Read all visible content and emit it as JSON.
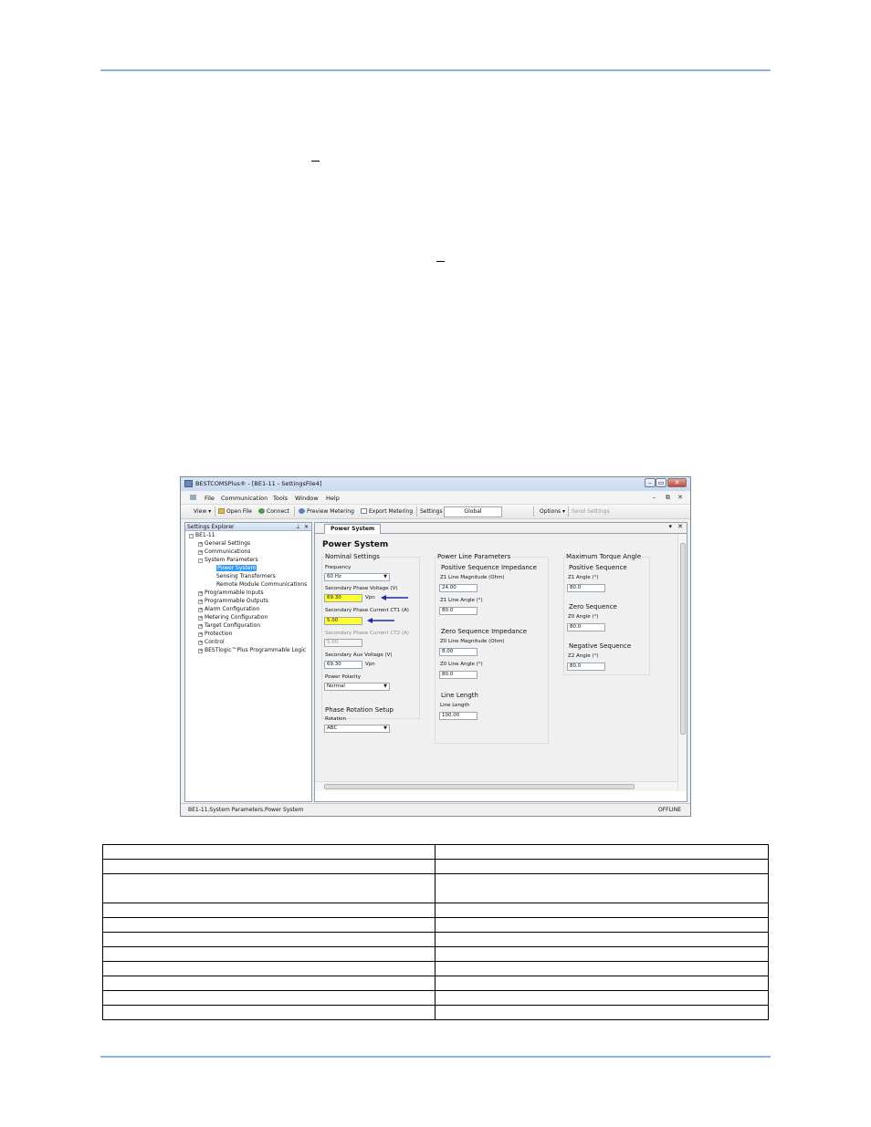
{
  "window": {
    "title": "BESTCOMSPlus® - [BE1-11 - SettingsFile4]",
    "controls": {
      "minimize": "–",
      "restore": "▭",
      "close": "✕"
    }
  },
  "menu": {
    "items": [
      "File",
      "Communication",
      "Tools",
      "Window",
      "Help"
    ],
    "right_controls": [
      "–",
      "⧉",
      "✕"
    ]
  },
  "toolbar": {
    "view": "View ▾",
    "open_file": "Open File",
    "connect": "Connect",
    "preview_metering": "Preview Metering",
    "export_metering": "Export Metering",
    "settings_label": "Settings",
    "settings_value": "Global",
    "options": "Options ▾",
    "send_settings": "Send Settings"
  },
  "explorer": {
    "title": "Settings Explorer",
    "pin": "⊥",
    "close": "✕",
    "root": "BE1-11",
    "items": [
      "General Settings",
      "Communications",
      "System Parameters",
      "Power System",
      "Sensing Transformers",
      "Remote Module Communications",
      "Programmable Inputs",
      "Programmable Outputs",
      "Alarm Configuration",
      "Metering Configuration",
      "Target Configuration",
      "Protection",
      "Control",
      "BESTlogic™Plus Programmable Logic"
    ]
  },
  "document": {
    "tab": "Power System",
    "heading": "Power System",
    "tab_controls": {
      "dropdown": "▾",
      "close": "✕"
    },
    "nominal": {
      "title": "Nominal Settings",
      "frequency_label": "Frequency",
      "frequency_value": "60 Hz",
      "sec_phase_voltage_label": "Secondary Phase Voltage (V)",
      "sec_phase_voltage_value": "69.30",
      "sec_phase_voltage_unit": "Vpn",
      "ct1_label": "Secondary Phase Current CT1 (A)",
      "ct1_value": "5.00",
      "ct2_label": "Secondary Phase Current CT2 (A)",
      "ct2_value": "5.00",
      "aux_voltage_label": "Secondary Aux Voltage (V)",
      "aux_voltage_value": "69.30",
      "aux_voltage_unit": "Vpn",
      "polarity_label": "Power Polarity",
      "polarity_value": "Normal"
    },
    "phase_rotation": {
      "title": "Phase Rotation Setup",
      "rotation_label": "Rotation",
      "rotation_value": "ABC"
    },
    "line_params": {
      "title": "Power Line Parameters",
      "pos_seq_title": "Positive Sequence Impedance",
      "z1_mag_label": "Z1 Line Magnitude (Ohm)",
      "z1_mag_value": "24.00",
      "z1_angle_label": "Z1 Line Angle (°)",
      "z1_angle_value": "80.0",
      "zero_seq_title": "Zero Sequence Impedance",
      "z0_mag_label": "Z0 Line Magnitude (Ohm)",
      "z0_mag_value": "8.00",
      "z0_angle_label": "Z0 Line Angle (°)",
      "z0_angle_value": "80.0",
      "line_length_title": "Line Length",
      "line_length_label": "Line Length",
      "line_length_value": "100.00"
    },
    "mta": {
      "title": "Maximum Torque Angle",
      "pos_title": "Positive Sequence",
      "z1_label": "Z1 Angle (°)",
      "z1_value": "80.0",
      "zero_title": "Zero Sequence",
      "z0_label": "Z0 Angle (°)",
      "z0_value": "80.0",
      "neg_title": "Negative Sequence",
      "z2_label": "Z2 Angle (°)",
      "z2_value": "80.0"
    }
  },
  "status": {
    "path": "BE1-11.System Parameters.Power System",
    "connection": "OFFLINE"
  },
  "colors": {
    "rule": "#8db3e2",
    "highlight": "#ffff33",
    "arrow": "#1f2aa8",
    "selection": "#3399ff"
  }
}
